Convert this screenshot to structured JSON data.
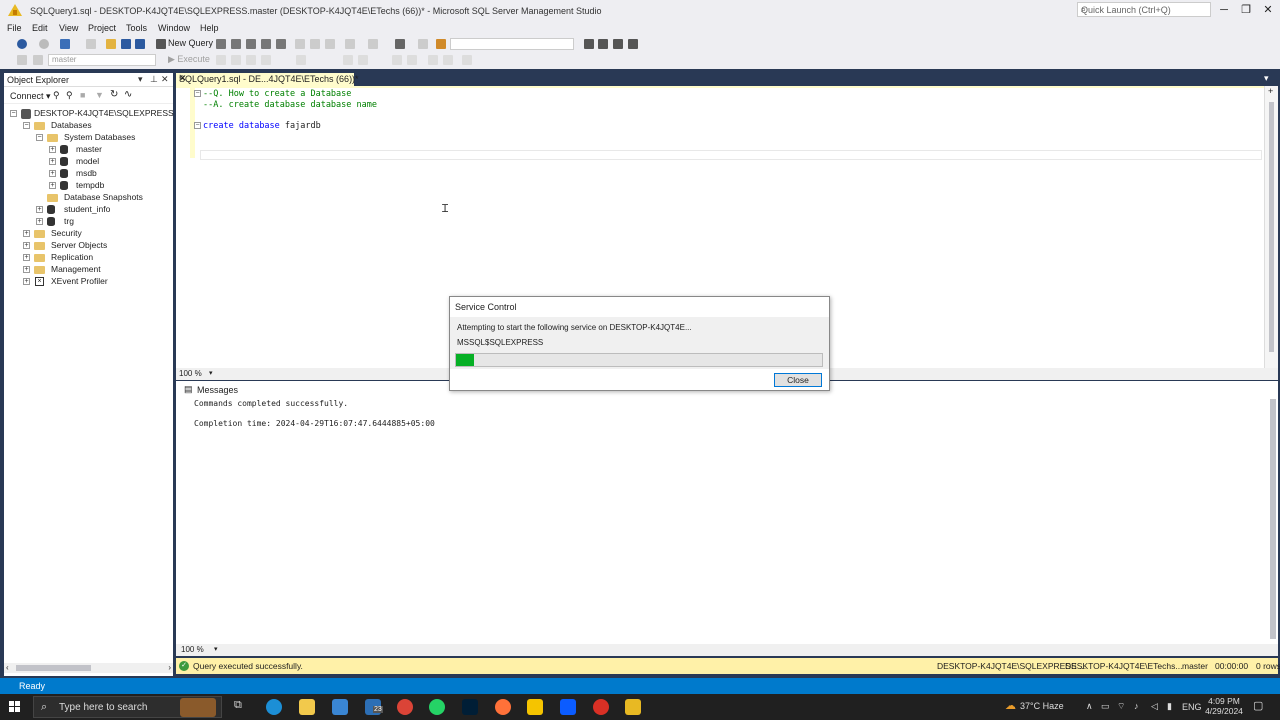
{
  "window": {
    "title": "SQLQuery1.sql - DESKTOP-K4JQT4E\\SQLEXPRESS.master (DESKTOP-K4JQT4E\\ETechs (66))* - Microsoft SQL Server Management Studio",
    "quick_launch_placeholder": "Quick Launch (Ctrl+Q)"
  },
  "menu": [
    "File",
    "Edit",
    "View",
    "Project",
    "Tools",
    "Window",
    "Help"
  ],
  "toolbar": {
    "new_query_label": "New Query",
    "execute_label": "Execute",
    "database_selected": "master"
  },
  "object_explorer": {
    "title": "Object Explorer",
    "connect_label": "Connect",
    "tree": [
      {
        "label": "DESKTOP-K4JQT4E\\SQLEXPRESS (SQL S",
        "icon": "server-icon",
        "expander": "−"
      },
      {
        "label": "Databases",
        "icon": "folder-icon",
        "expander": "−"
      },
      {
        "label": "System Databases",
        "icon": "folder-icon",
        "expander": "−"
      },
      {
        "label": "master",
        "icon": "database-icon",
        "expander": "+"
      },
      {
        "label": "model",
        "icon": "database-icon",
        "expander": "+"
      },
      {
        "label": "msdb",
        "icon": "database-icon",
        "expander": "+"
      },
      {
        "label": "tempdb",
        "icon": "database-icon",
        "expander": "+"
      },
      {
        "label": "Database Snapshots",
        "icon": "folder-icon",
        "expander": ""
      },
      {
        "label": "student_info",
        "icon": "database-icon",
        "expander": "+"
      },
      {
        "label": "trg",
        "icon": "database-icon",
        "expander": "+"
      },
      {
        "label": "Security",
        "icon": "folder-icon",
        "expander": "+"
      },
      {
        "label": "Server Objects",
        "icon": "folder-icon",
        "expander": "+"
      },
      {
        "label": "Replication",
        "icon": "folder-icon",
        "expander": "+"
      },
      {
        "label": "Management",
        "icon": "folder-icon",
        "expander": "+"
      },
      {
        "label": "XEvent Profiler",
        "icon": "profiler-icon",
        "expander": "+"
      }
    ]
  },
  "editor": {
    "tab_label": "SQLQuery1.sql - DE...4JQT4E\\ETechs (66))*",
    "lines": {
      "c1": "--Q. How to create a Database",
      "c2": "--A. create database database name",
      "kw1": "create",
      "kw2": "database",
      "ident": "fajardb"
    },
    "zoom": "100 %"
  },
  "results": {
    "tab_label": "Messages",
    "line1": "Commands completed successfully.",
    "line2": "Completion time: 2024-04-29T16:07:47.6444885+05:00",
    "zoom": "100 %"
  },
  "status": {
    "message": "Query executed successfully.",
    "server": "DESKTOP-K4JQT4E\\SQLEXPRESS ...",
    "user": "DESKTOP-K4JQT4E\\ETechs...",
    "database": "master",
    "elapsed": "00:00:00",
    "rows": "0 rows",
    "ready": "Ready"
  },
  "dialog": {
    "title": "Service Control",
    "message": "Attempting to start the following service on DESKTOP-K4JQT4E...",
    "service": "MSSQL$SQLEXPRESS",
    "progress": 0.05,
    "close_label": "Close"
  },
  "taskbar": {
    "search_placeholder": "Type here to search",
    "weather": "37°C  Haze",
    "language": "ENG",
    "time": "4:09 PM",
    "date": "4/29/2024",
    "mail_badge": "23"
  },
  "colors": {
    "frame_blue": "#293955",
    "status_yellow": "#fff1a8",
    "status_blue": "#007acc",
    "progress_green": "#06b025"
  }
}
